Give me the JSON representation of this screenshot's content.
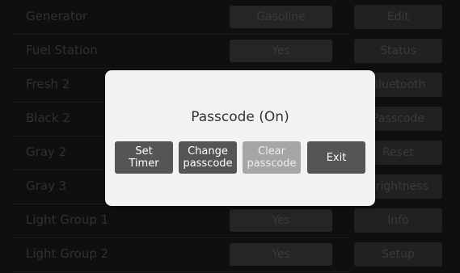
{
  "rows": [
    {
      "label": "Generator",
      "value": "Gasoline"
    },
    {
      "label": "Fuel Station",
      "value": "Yes"
    },
    {
      "label": "Fresh 2",
      "value": ""
    },
    {
      "label": "Black 2",
      "value": ""
    },
    {
      "label": "Gray 2",
      "value": ""
    },
    {
      "label": "Gray 3",
      "value": ""
    },
    {
      "label": "Light Group 1",
      "value": "Yes"
    },
    {
      "label": "Light Group 2",
      "value": "Yes"
    }
  ],
  "side_buttons": [
    "Edit",
    "Status",
    "Bluetooth",
    "Passcode",
    "Reset",
    "Brightness",
    "Info",
    "Setup"
  ],
  "modal": {
    "title": "Passcode (On)",
    "buttons": {
      "set_timer": "Set\nTimer",
      "change_passcode": "Change\npasscode",
      "clear_passcode": "Clear\npasscode",
      "exit": "Exit"
    }
  }
}
